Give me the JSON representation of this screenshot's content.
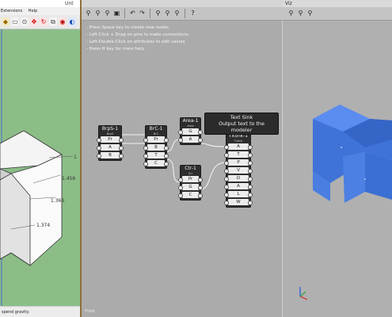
{
  "sketchup": {
    "title": "Unt",
    "menu": [
      "Extensions",
      "Help"
    ],
    "dimensions": [
      "1",
      "1.456",
      "1.366",
      "1.374"
    ],
    "status_text": "spend gravity."
  },
  "editor": {
    "title": "",
    "hints": [
      "- Press Space key to create new nodes",
      "- Left-Click + Drag on pins to make connections",
      "- Left-Double-Click on attributes to edit values",
      "- Press H key for more help"
    ],
    "tooltip": {
      "line1": "Text Sink",
      "line2": "Output text to the modeler"
    },
    "nodes": {
      "brps": {
        "title": "BrpS-1",
        "sub": "BrpS",
        "ports": [
          "Pr",
          "A",
          "B"
        ]
      },
      "brc": {
        "title": "BrC-1",
        "sub": "BrC",
        "ports": [
          "Pr",
          "B",
          "T",
          "C"
        ]
      },
      "area": {
        "title": "Area-1",
        "sub": "Area",
        "ports": [
          "G",
          "A"
        ]
      },
      "ctr": {
        "title": "Ctr-1",
        "sub": "Ctr",
        "ports": [
          "Pr",
          "G",
          "C"
        ]
      },
      "txsnk": {
        "title": "TxSnk-1",
        "sub": "TxSnk",
        "ports": [
          "A",
          "T",
          "P",
          "V",
          "D",
          "A",
          "L",
          "W"
        ]
      }
    },
    "view_label": "Front"
  },
  "viewer": {
    "title": "Viz",
    "model_color": "#4b7fe0"
  }
}
